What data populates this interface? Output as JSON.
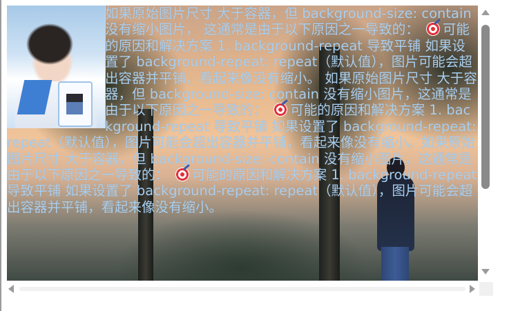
{
  "content": {
    "segments": [
      "如果原始图片尺寸 大于容器，但 background-size: contain 没有缩小图片， 这通常是由于以下原因之一导致的：",
      "可能的原因和解决方案 1. background-repeat 导致平铺 如果设置了 background-repeat: repeat（默认值），图片可能会超出容器并平铺，看起来像没有缩小。 如果原始图片尺寸 大于容器，但 background-size: contain 没有缩小图片，这通常是由于以下原因之一导致的：",
      "可能的原因和解决方案 1. background-repeat 导致平铺 如果设置了 background-repeat: repeat（默认值），图片可能会超出容器并平铺，看起来像没有缩小。如果原始图片尺寸 大于容器，但 background-size: contain 没有缩小图片，这通常是由于以下原因之一导致的：",
      "可能的原因和解决方案 1. background-repeat 导致平铺 如果设置了 background-repeat: repeat（默认值），图片可能会超出容器并平铺，看起来像没有缩小。"
    ],
    "emoji_icon": "target-icon"
  },
  "colors": {
    "text": "#a9cff0",
    "scrollbar_thumb": "#8a8a8a",
    "scrollbar_arrow": "#9b9b9b"
  },
  "scrollbars": {
    "vertical_icon_up": "arrow-up-icon",
    "vertical_icon_down": "arrow-down-icon",
    "horizontal_icon_left": "arrow-left-icon",
    "horizontal_icon_right": "arrow-right-icon"
  }
}
